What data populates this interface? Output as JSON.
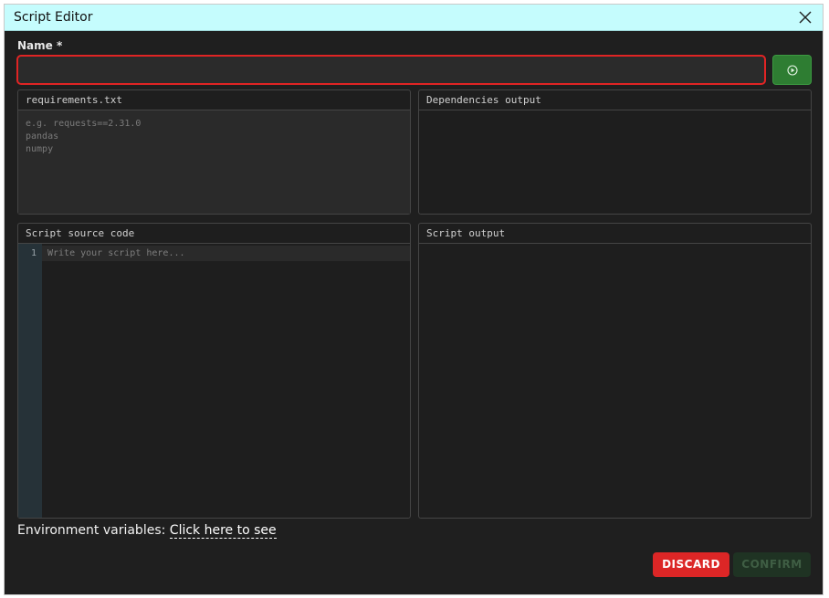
{
  "dialog": {
    "title": "Script Editor",
    "close_icon": "close-icon"
  },
  "name_field": {
    "label": "Name *",
    "value": "",
    "placeholder": "",
    "state": "error"
  },
  "run_button": {
    "icon": "play-circle-icon"
  },
  "requirements": {
    "header": "requirements.txt",
    "placeholder": "e.g. requests==2.31.0\npandas\nnumpy",
    "value": ""
  },
  "dependencies_output": {
    "header": "Dependencies output",
    "content": ""
  },
  "script_source": {
    "header": "Script source code",
    "line_number": "1",
    "placeholder": "Write your script here..."
  },
  "script_output": {
    "header": "Script output",
    "content": ""
  },
  "environment": {
    "label": "Environment variables:",
    "link_text": "Click here to see"
  },
  "actions": {
    "discard_label": "DISCARD",
    "confirm_label": "CONFIRM"
  },
  "colors": {
    "title_bar": "#c5fcfd",
    "dialog_background": "#1f1f1f",
    "error_border": "#e02424",
    "run_button": "#2e7d32",
    "discard": "#dc2626",
    "confirm_disabled": "#1f3323"
  }
}
